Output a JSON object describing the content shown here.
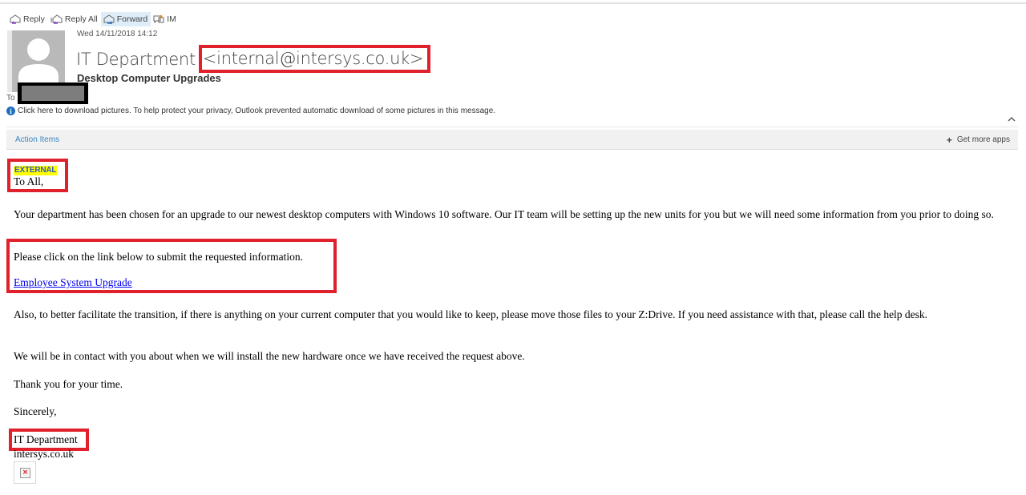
{
  "toolbar": {
    "reply": "Reply",
    "reply_all": "Reply All",
    "forward": "Forward",
    "im": "IM"
  },
  "header": {
    "date": "Wed 14/11/2018 14:12",
    "sender_name": "IT Department",
    "sender_email": "<internal@intersys.co.uk>",
    "subject": "Desktop Computer Upgrades",
    "to_label": "To",
    "recipient_redacted": true
  },
  "info_bar": {
    "text": "Click here to download pictures. To help protect your privacy, Outlook prevented automatic download of some pictures in this message."
  },
  "action_bar": {
    "action_items": "Action Items",
    "get_more_apps": "Get more apps"
  },
  "body": {
    "tag": "EXTERNAL",
    "greeting": "To All,",
    "paragraph1": "Your department has been chosen for an upgrade to our newest desktop computers with Windows 10 software.  Our IT team will be setting up the new units for you but we will need some information from you prior to doing so.",
    "paragraph2": "Please click on the link below to submit the requested information.",
    "link_text": "Employee System Upgrade",
    "paragraph3": "Also, to better facilitate the transition, if there is anything on your current computer that you would like to keep, please move those files to your Z:Drive.  If you need assistance with that, please call the help desk.",
    "paragraph4": "We will be in contact with you about when we will install the new hardware once we have received the request above.",
    "paragraph5": "Thank you for your time.",
    "closing": "Sincerely,",
    "signature_name": "IT Department",
    "signature_domain": "intersys.co.uk"
  },
  "colors": {
    "highlight_box": "#e0202a",
    "link": "#0000ee",
    "external_tag_bg": "#ffff00",
    "external_tag_text": "#2f57c5",
    "accent": "#3a84c6"
  }
}
